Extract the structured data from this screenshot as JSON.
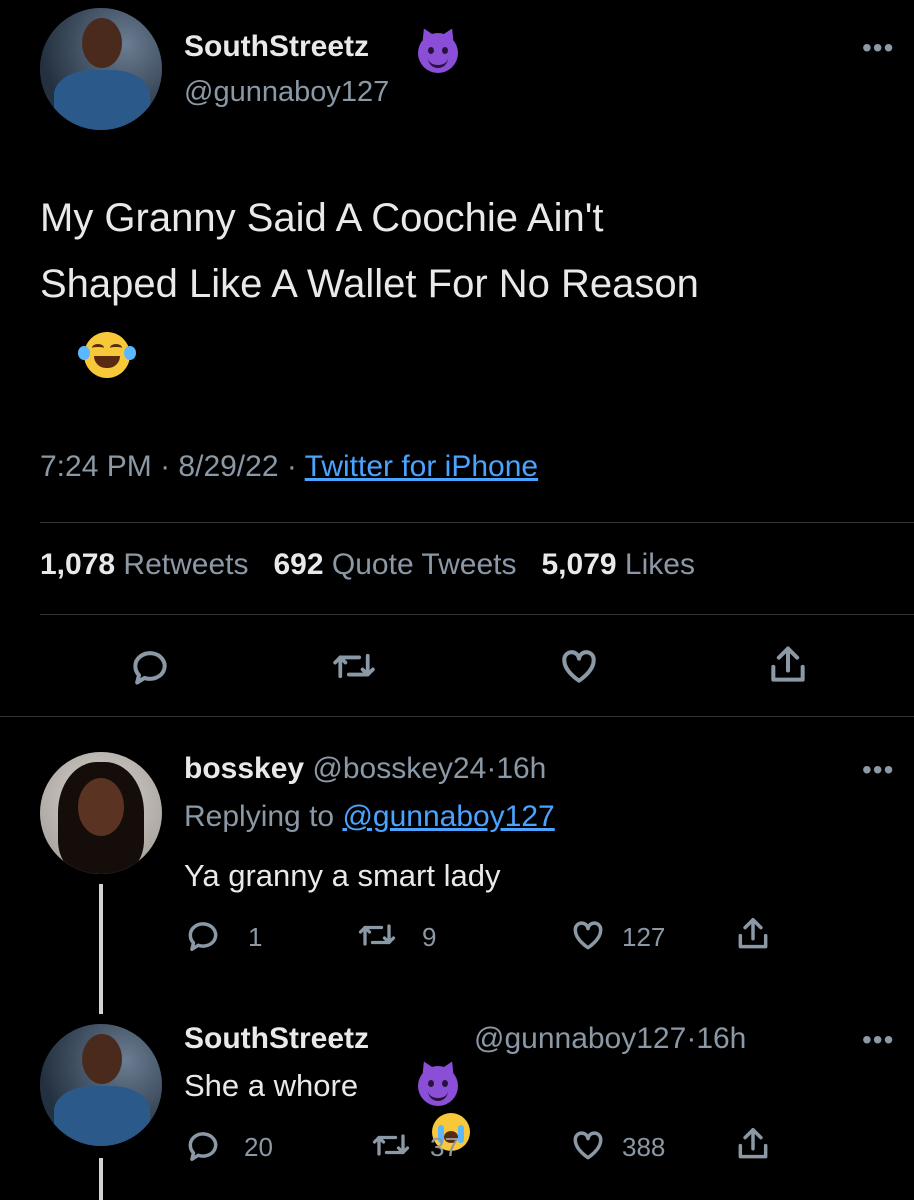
{
  "main_tweet": {
    "display_name": "SouthStreetz",
    "badge_icon": "smiling-devil-emoji",
    "handle": "@gunnaboy127",
    "text_line1": "My Granny Said A Coochie Ain't",
    "text_line2": "Shaped Like A Wallet For No Reason",
    "emoji": "tears-of-joy-emoji",
    "time": "7:24 PM",
    "date": "8/29/22",
    "source": "Twitter for iPhone",
    "separator": "·",
    "stats": {
      "retweets_count": "1,078",
      "retweets_label": "Retweets",
      "quotes_count": "692",
      "quotes_label": "Quote Tweets",
      "likes_count": "5,079",
      "likes_label": "Likes"
    },
    "actions": [
      "reply-icon",
      "retweet-icon",
      "like-icon",
      "share-icon"
    ]
  },
  "replies": [
    {
      "display_name": "bosskey",
      "handle": "@bosskey24",
      "time": "16h",
      "replying_prefix": "Replying to",
      "replying_handle": "@gunnaboy127",
      "text": "Ya granny a smart lady",
      "reply_count": "1",
      "retweet_count": "9",
      "like_count": "127"
    },
    {
      "display_name": "SouthStreetz",
      "badge_icon": "smiling-devil-emoji",
      "handle": "@gunnaboy127",
      "time": "16h",
      "text": "She a whore",
      "emoji": "loudly-crying-emoji",
      "reply_count": "20",
      "retweet_count": "37",
      "like_count": "388"
    }
  ],
  "colors": {
    "background": "#000000",
    "text": "#e7e9ea",
    "muted": "#8b98a5",
    "link": "#4aa3ff",
    "divider": "#2f3336"
  }
}
